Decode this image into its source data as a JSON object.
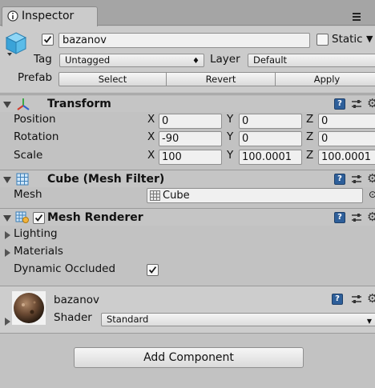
{
  "tab": {
    "label": "Inspector"
  },
  "gameobject": {
    "name": "bazanov",
    "static_label": "Static",
    "tag_label": "Tag",
    "tag_value": "Untagged",
    "layer_label": "Layer",
    "layer_value": "Default",
    "prefab_label": "Prefab",
    "buttons": {
      "select": "Select",
      "revert": "Revert",
      "apply": "Apply"
    }
  },
  "transform": {
    "title": "Transform",
    "position": {
      "label": "Position",
      "x": "0",
      "y": "0",
      "z": "0"
    },
    "rotation": {
      "label": "Rotation",
      "x": "-90",
      "y": "0",
      "z": "0"
    },
    "scale": {
      "label": "Scale",
      "x": "100",
      "y": "100.0001",
      "z": "100.0001"
    },
    "axis": {
      "x": "X",
      "y": "Y",
      "z": "Z"
    }
  },
  "mesh_filter": {
    "title": "Cube (Mesh Filter)",
    "mesh_label": "Mesh",
    "mesh_value": "Cube"
  },
  "mesh_renderer": {
    "title": "Mesh Renderer",
    "lighting": "Lighting",
    "materials": "Materials",
    "dynamic_occluded": "Dynamic Occluded"
  },
  "material": {
    "name": "bazanov",
    "shader_label": "Shader",
    "shader_value": "Standard"
  },
  "footer": {
    "add_component": "Add Component"
  },
  "colors": {
    "background": "#c2c2c2",
    "header": "#c5c5c5",
    "help_icon": "#2e5f9a",
    "field": "#f0f0f0"
  }
}
